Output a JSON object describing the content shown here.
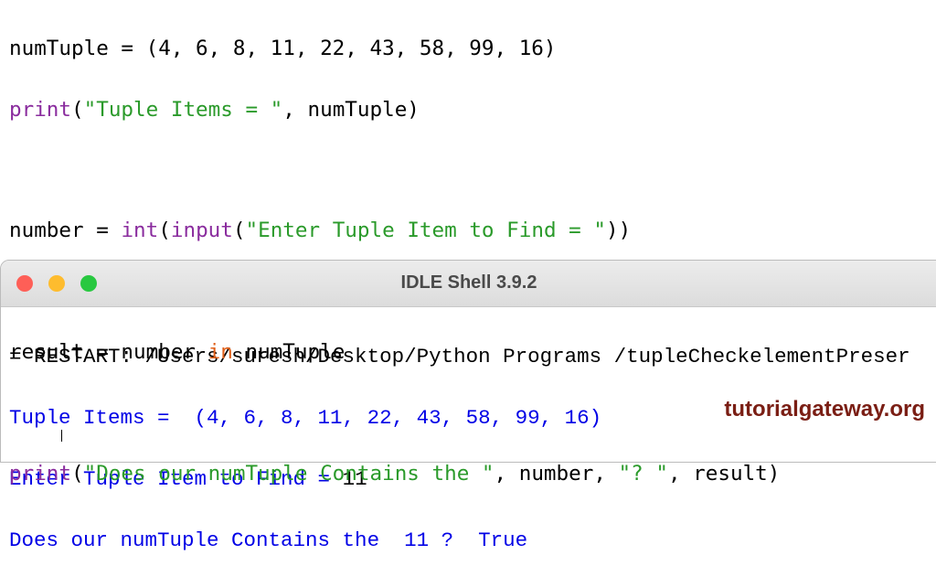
{
  "code": {
    "line1": {
      "text": "numTuple = (4, 6, 8, 11, 22, 43, 58, 99, 16)"
    },
    "line2": {
      "fn": "print",
      "open": "(",
      "str": "\"Tuple Items = \"",
      "rest": ", numTuple)"
    },
    "line4": {
      "pre": "number = ",
      "fn1": "int",
      "mid": "(",
      "fn2": "input",
      "open": "(",
      "str": "\"Enter Tuple Item to Find = \"",
      "close": "))"
    },
    "line6": {
      "pre": "result = number ",
      "kw": "in",
      "post": " numTuple"
    },
    "line8": {
      "fn": "print",
      "open": "(",
      "str1": "\"Does our numTuple Contains the \"",
      "mid": ", number, ",
      "str2": "\"? \"",
      "rest": ", result)"
    }
  },
  "shell": {
    "title": "IDLE Shell 3.9.2",
    "restart": "= RESTART: /Users/suresh/Desktop/Python Programs /tupleCheckelementPreser",
    "out1": "Tuple Items =  (4, 6, 8, 11, 22, 43, 58, 99, 16)",
    "prompt": "Enter Tuple Item to Find = ",
    "input": "11",
    "out2": "Does our numTuple Contains the  11 ?  True"
  },
  "watermark": "tutorialgateway.org",
  "colors": {
    "keyword": "#8a2c9e",
    "string": "#2a9a2a",
    "in": "#e0601a",
    "output": "#0000e6"
  }
}
